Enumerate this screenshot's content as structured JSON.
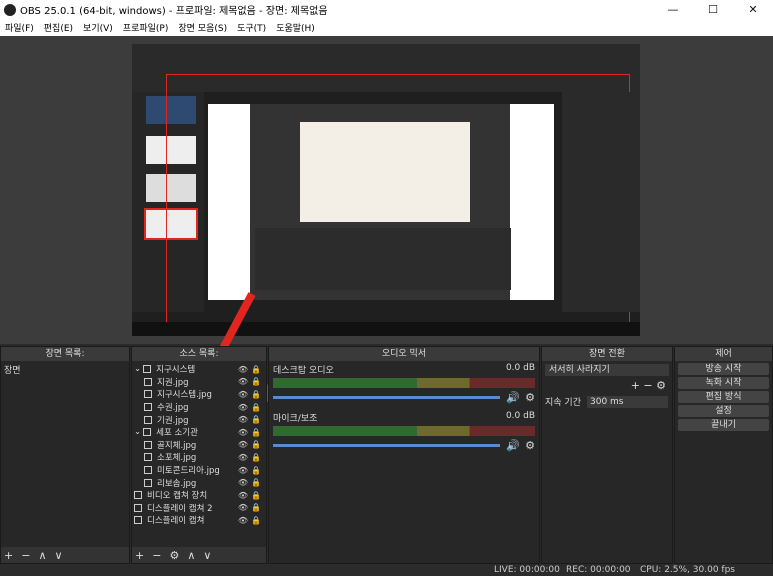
{
  "titlebar": {
    "title": "OBS 25.0.1 (64-bit, windows) - 프로파일: 제목없음 - 장면: 제목없음"
  },
  "menu": [
    "파일(F)",
    "편집(E)",
    "보기(V)",
    "프로파일(P)",
    "장면 모음(S)",
    "도구(T)",
    "도움말(H)"
  ],
  "panels": {
    "scenes": {
      "title": "장면 목록:",
      "items": [
        "장면"
      ]
    },
    "sources": {
      "title": "소스 목록:",
      "items": [
        {
          "label": "지구시스템",
          "type": "folder",
          "indent": 0
        },
        {
          "label": "지권.jpg",
          "type": "image",
          "indent": 1
        },
        {
          "label": "지구시스템.jpg",
          "type": "image",
          "indent": 1
        },
        {
          "label": "수권.jpg",
          "type": "image",
          "indent": 1
        },
        {
          "label": "기권.jpg",
          "type": "image",
          "indent": 1
        },
        {
          "label": "세포 소기관",
          "type": "folder",
          "indent": 0
        },
        {
          "label": "골지체.jpg",
          "type": "image",
          "indent": 1
        },
        {
          "label": "소포체.jpg",
          "type": "image",
          "indent": 1
        },
        {
          "label": "미토콘드리아.jpg",
          "type": "image",
          "indent": 1
        },
        {
          "label": "리보솜.jpg",
          "type": "image",
          "indent": 1
        },
        {
          "label": "비디오 캡쳐 장치",
          "type": "camera",
          "indent": 0
        },
        {
          "label": "디스플레이 캡쳐 2",
          "type": "display",
          "indent": 0
        },
        {
          "label": "디스플레이 캡쳐",
          "type": "display",
          "indent": 0
        }
      ]
    },
    "mixer": {
      "title": "오디오 믹서",
      "channels": [
        {
          "name": "데스크탑 오디오",
          "db": "0.0 dB"
        },
        {
          "name": "마이크/보조",
          "db": "0.0 dB"
        }
      ]
    },
    "transitions": {
      "title": "장면 전환",
      "type": "서서히 사라지기",
      "duration_label": "지속 기간",
      "duration": "300 ms"
    },
    "controls": {
      "title": "제어",
      "buttons": [
        "방송 시작",
        "녹화 시작",
        "편집 방식",
        "설정",
        "끝내기"
      ]
    }
  },
  "status": {
    "live": "LIVE: 00:00:00",
    "rec": "REC: 00:00:00",
    "cpu": "CPU: 2.5%, 30.00 fps"
  },
  "colors": {
    "accent_red": "#e0261f",
    "meter_green": "#3a9a3a"
  }
}
